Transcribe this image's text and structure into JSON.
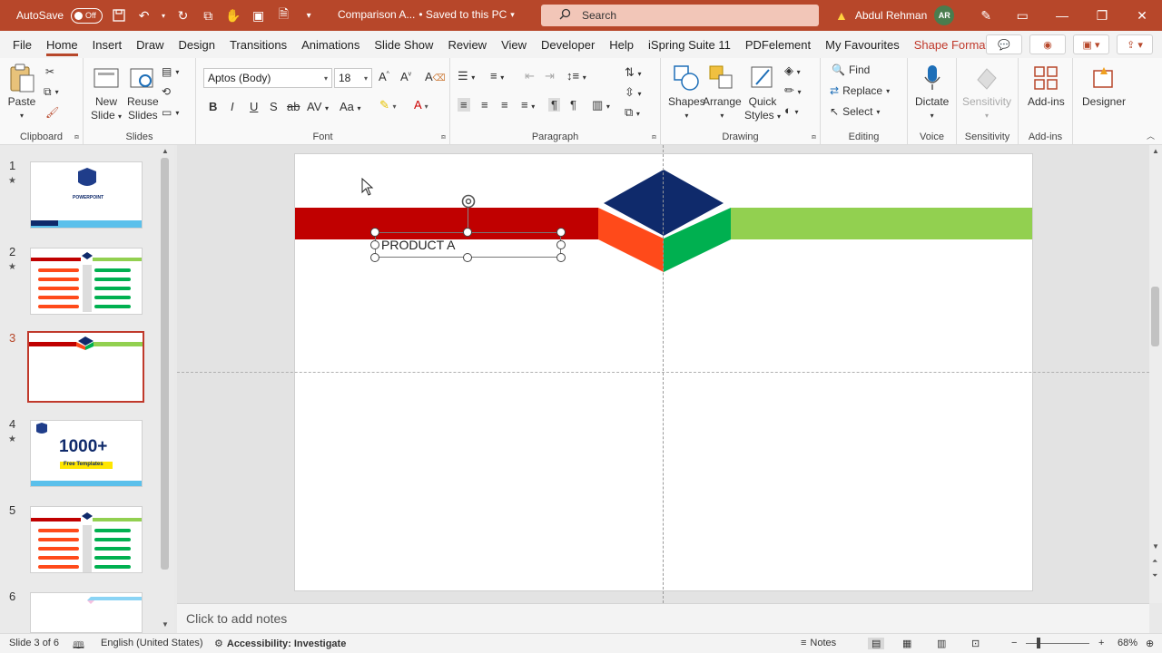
{
  "titlebar": {
    "autosave_label": "AutoSave",
    "autosave_state": "Off",
    "doc_title": "Comparison A...",
    "saved_status": "• Saved to this PC",
    "search_placeholder": "Search",
    "user_name": "Abdul Rehman",
    "user_initials": "AR"
  },
  "menu": {
    "tabs": [
      "File",
      "Home",
      "Insert",
      "Draw",
      "Design",
      "Transitions",
      "Animations",
      "Slide Show",
      "Review",
      "View",
      "Developer",
      "Help",
      "iSpring Suite 11",
      "PDFelement",
      "My Favourites",
      "Shape Format"
    ],
    "active": "Home"
  },
  "ribbon": {
    "clipboard": {
      "paste": "Paste",
      "label": "Clipboard"
    },
    "slides": {
      "new_slide_1": "New",
      "new_slide_2": "Slide",
      "reuse_1": "Reuse",
      "reuse_2": "Slides",
      "label": "Slides"
    },
    "font": {
      "family": "Aptos (Body)",
      "size": "18",
      "label": "Font"
    },
    "paragraph": {
      "label": "Paragraph"
    },
    "drawing": {
      "shapes": "Shapes",
      "arrange": "Arrange",
      "quick_1": "Quick",
      "quick_2": "Styles",
      "label": "Drawing"
    },
    "editing": {
      "find": "Find",
      "replace": "Replace",
      "select": "Select",
      "label": "Editing"
    },
    "voice": {
      "dictate": "Dictate",
      "label": "Voice"
    },
    "sensitivity": {
      "button": "Sensitivity",
      "label": "Sensitivity"
    },
    "addins": {
      "button": "Add-ins",
      "label": "Add-ins"
    },
    "designer": {
      "button": "Designer"
    }
  },
  "slides_pane": {
    "numbers": [
      "1",
      "2",
      "3",
      "4",
      "5",
      "6"
    ],
    "thumb1_title": "POWERPOINT",
    "thumb4_big": "1000+",
    "thumb4_sub": "Free Templates"
  },
  "slide": {
    "textbox_text": "PRODUCT A"
  },
  "notes": {
    "placeholder": "Click to add notes"
  },
  "status": {
    "slide_info": "Slide 3 of 6",
    "language": "English (United States)",
    "accessibility": "Accessibility: Investigate",
    "notes_btn": "Notes",
    "zoom": "68%"
  },
  "colors": {
    "brand": "#b7472a",
    "slide_red": "#c00000",
    "slide_green": "#92d050",
    "diamond_navy": "#0f2a6b",
    "diamond_orange": "#ff4a1a",
    "diamond_green": "#00b050"
  }
}
